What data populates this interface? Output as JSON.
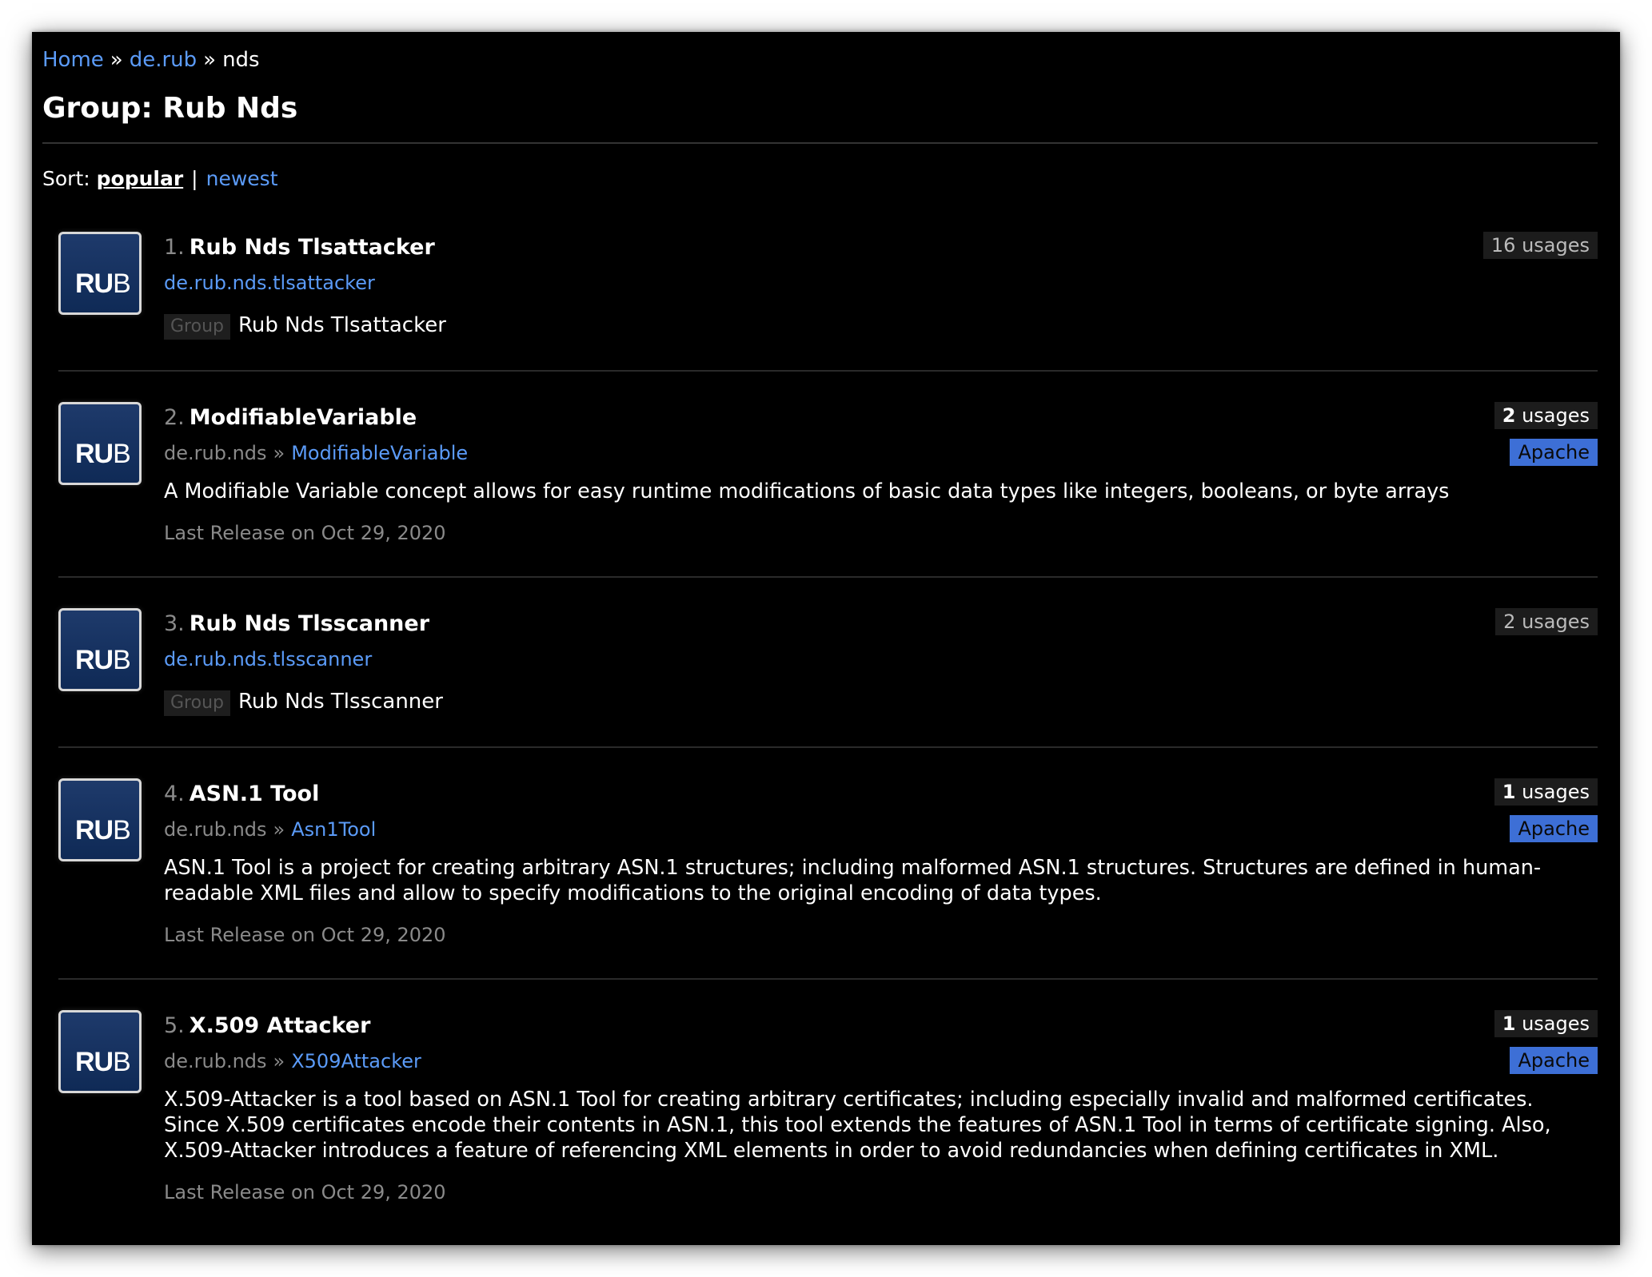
{
  "breadcrumb": {
    "home": "Home",
    "sep": "»",
    "group": "de.rub",
    "current": "nds"
  },
  "page_title": "Group: Rub Nds",
  "sort": {
    "label": "Sort:",
    "popular": "popular",
    "pipe": "|",
    "newest": "newest"
  },
  "logo": {
    "bold": "RU",
    "thin": "B"
  },
  "colors": {
    "background": "#000000",
    "link": "#5b9bf8",
    "license_badge": "#3d6fd6"
  },
  "items": [
    {
      "num": "1.",
      "title": "Rub Nds Tlsattacker",
      "usages_count": "16",
      "usages_label": "usages",
      "coords_full": "de.rub.nds.tlsattacker",
      "tag": "Group",
      "tag_text": "Rub Nds Tlsattacker"
    },
    {
      "num": "2.",
      "title": "ModifiableVariable",
      "usages_count": "2",
      "usages_label": "usages",
      "license": "Apache",
      "coords_group": "de.rub.nds",
      "coords_sep": "»",
      "coords_artifact": "ModifiableVariable",
      "description": "A Modifiable Variable concept allows for easy runtime modifications of basic data types like integers, booleans, or byte arrays",
      "release_prefix": "Last Release on",
      "release_date": "Oct 29, 2020"
    },
    {
      "num": "3.",
      "title": "Rub Nds Tlsscanner",
      "usages_count": "2",
      "usages_label": "usages",
      "coords_full": "de.rub.nds.tlsscanner",
      "tag": "Group",
      "tag_text": "Rub Nds Tlsscanner"
    },
    {
      "num": "4.",
      "title": "ASN.1 Tool",
      "usages_count": "1",
      "usages_label": "usages",
      "license": "Apache",
      "coords_group": "de.rub.nds",
      "coords_sep": "»",
      "coords_artifact": "Asn1Tool",
      "description_lines": [
        "ASN.1 Tool is a project for creating arbitrary ASN.1 structures; including malformed ASN.1 structures. Structures are defined in human-",
        "readable XML files and allow to specify modifications to the original encoding of data types."
      ],
      "release_prefix": "Last Release on",
      "release_date": "Oct 29, 2020"
    },
    {
      "num": "5.",
      "title": "X.509 Attacker",
      "usages_count": "1",
      "usages_label": "usages",
      "license": "Apache",
      "coords_group": "de.rub.nds",
      "coords_sep": "»",
      "coords_artifact": "X509Attacker",
      "description_lines": [
        "X.509-Attacker is a tool based on ASN.1 Tool for creating arbitrary certificates; including especially invalid and malformed certificates.",
        "Since X.509 certificates encode their contents in ASN.1, this tool extends the features of ASN.1 Tool in terms of certificate signing. Also,",
        "X.509-Attacker introduces a feature of referencing XML elements in order to avoid redundancies when defining certificates in XML."
      ],
      "release_prefix": "Last Release on",
      "release_date": "Oct 29, 2020"
    }
  ]
}
